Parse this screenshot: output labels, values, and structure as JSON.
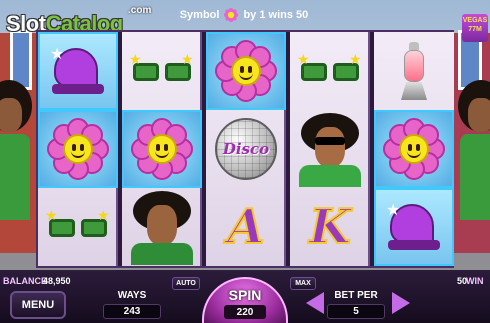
{
  "logo": {
    "part1": "Slot",
    "part2": "Catalog",
    "suffix": ".com"
  },
  "top_badge": "VEGAS 77M",
  "message": {
    "prefix": "Symbol",
    "suffix": "by 1 wins 50"
  },
  "reels": [
    [
      "shoe",
      "flower",
      "glasses"
    ],
    [
      "glasses",
      "flower",
      "man"
    ],
    [
      "flower",
      "disco",
      "A"
    ],
    [
      "glasses",
      "woman",
      "K"
    ],
    [
      "lava-lamp",
      "flower",
      "shoe"
    ]
  ],
  "symbol_text": {
    "disco": "Disco",
    "A": "A",
    "K": "K"
  },
  "footer": {
    "balance_label": "BALANCE",
    "balance_value": "48,950",
    "win_value": "50",
    "win_label": "WIN",
    "menu_label": "MENU",
    "ways_label": "WAYS",
    "ways_value": "243",
    "auto_label": "AUTO",
    "spin_label": "SPIN",
    "spin_value": "220",
    "max_label": "MAX",
    "bet_label": "BET PER",
    "bet_value": "5"
  },
  "colors": {
    "accent": "#c66be8",
    "highlight": "#3fc9ff",
    "flower_petal": "#e765c9"
  }
}
